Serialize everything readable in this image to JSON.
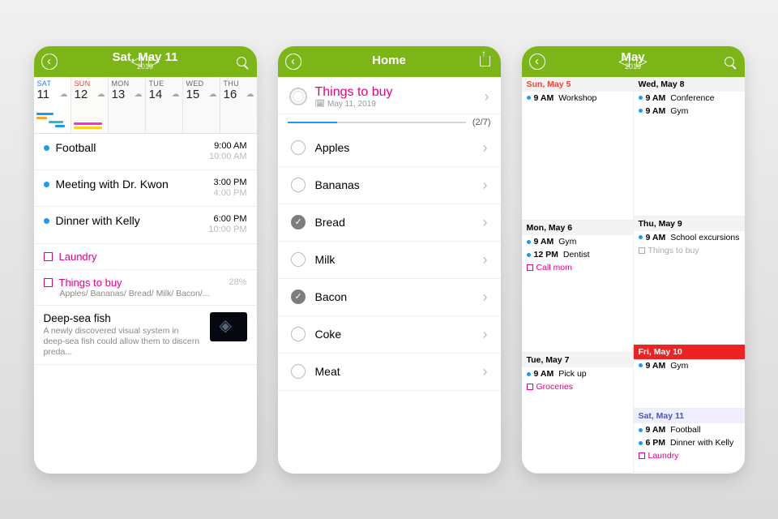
{
  "phone1": {
    "title": "Sat, May 11",
    "subtitle": "2019",
    "days": [
      {
        "dow": "SAT",
        "num": "11",
        "cls": "sat",
        "bars": [
          {
            "c": "#1c9af0",
            "w": "55%"
          },
          {
            "c": "#f5a623",
            "w": "35%"
          },
          {
            "c": "#1cc5b7",
            "w": "45%",
            "ml": "40%"
          },
          {
            "c": "#1c9af0",
            "w": "30%",
            "ml": "60%"
          }
        ]
      },
      {
        "dow": "SUN",
        "num": "12",
        "cls": "sun sel",
        "bars": [
          {
            "c": "#ff2dd0",
            "w": "90%"
          },
          {
            "c": "#ffd21c",
            "w": "90%"
          }
        ]
      },
      {
        "dow": "MON",
        "num": "13",
        "cls": ""
      },
      {
        "dow": "TUE",
        "num": "14",
        "cls": ""
      },
      {
        "dow": "WED",
        "num": "15",
        "cls": ""
      },
      {
        "dow": "THU",
        "num": "16",
        "cls": ""
      }
    ],
    "events": [
      {
        "title": "Football",
        "t1": "9:00 AM",
        "t2": "10:00 AM"
      },
      {
        "title": "Meeting with Dr. Kwon",
        "t1": "3:00 PM",
        "t2": "4:00 PM"
      },
      {
        "title": "Dinner with Kelly",
        "t1": "6:00 PM",
        "t2": "10:00 PM"
      }
    ],
    "todos": [
      {
        "title": "Laundry"
      },
      {
        "title": "Things to buy",
        "sub": "Apples/ Bananas/ Bread/ Milk/ Bacon/...",
        "pct": "28%"
      }
    ],
    "news": {
      "h": "Deep-sea fish",
      "d": "A newly discovered visual system in deep-sea fish could allow them to discern preda..."
    }
  },
  "phone2": {
    "title": "Home",
    "list_title": "Things to buy",
    "list_date": "May 11, 2019",
    "counter": "(2/7)",
    "progress_pct": 28,
    "items": [
      {
        "label": "Apples",
        "done": false
      },
      {
        "label": "Bananas",
        "done": false
      },
      {
        "label": "Bread",
        "done": true
      },
      {
        "label": "Milk",
        "done": false
      },
      {
        "label": "Bacon",
        "done": true
      },
      {
        "label": "Coke",
        "done": false
      },
      {
        "label": "Meat",
        "done": false
      }
    ]
  },
  "phone3": {
    "title": "May",
    "subtitle": "2019",
    "left": [
      {
        "hdr": "Sun, May 5",
        "cls": "sun",
        "flex": "1.2",
        "evts": [
          {
            "tm": "9 AM",
            "txt": "Workshop"
          }
        ]
      },
      {
        "hdr": "Mon, May 6",
        "cls": "",
        "flex": "1.1",
        "evts": [
          {
            "tm": "9 AM",
            "txt": "Gym"
          },
          {
            "tm": "12 PM",
            "txt": "Dentist"
          },
          {
            "todo": true,
            "txt": "Call mom"
          }
        ]
      },
      {
        "hdr": "Tue, May 7",
        "cls": "",
        "flex": "1",
        "evts": [
          {
            "tm": "9 AM",
            "txt": "Pick up"
          },
          {
            "todo": true,
            "txt": "Groceries"
          }
        ]
      }
    ],
    "right": [
      {
        "hdr": "Wed, May 8",
        "cls": "",
        "flex": "1.2",
        "evts": [
          {
            "tm": "9 AM",
            "txt": "Conference"
          },
          {
            "tm": "9 AM",
            "txt": "Gym"
          }
        ]
      },
      {
        "hdr": "Thu, May 9",
        "cls": "",
        "flex": "1.1",
        "evts": [
          {
            "tm": "9 AM",
            "txt": "School excursions"
          },
          {
            "todo": true,
            "gray": true,
            "txt": "Things to buy"
          }
        ]
      },
      {
        "hdr": "Fri, May 10",
        "cls": "today",
        "flex": "0.55",
        "evts": [
          {
            "tm": "9 AM",
            "txt": "Gym"
          }
        ]
      },
      {
        "hdr": "Sat, May 11",
        "cls": "sat",
        "flex": "0.55",
        "evts": [
          {
            "tm": "9 AM",
            "txt": "Football"
          },
          {
            "tm": "6 PM",
            "txt": "Dinner with Kelly"
          },
          {
            "todo": true,
            "txt": "Laundry"
          }
        ]
      }
    ]
  }
}
